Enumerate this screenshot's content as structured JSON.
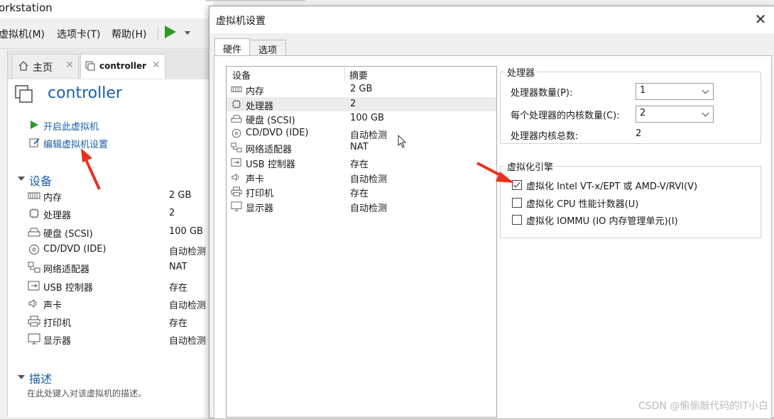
{
  "background_window": {
    "title": "orkstation",
    "menu": [
      "虚拟机(M)",
      "选项卡(T)",
      "帮助(H)"
    ],
    "tabs": [
      {
        "label": "主页"
      },
      {
        "label": "controller"
      }
    ],
    "vm_name": "controller",
    "actions": [
      "开启此虚拟机",
      "编辑虚拟机设置"
    ],
    "devices_section": "设备",
    "devices": [
      {
        "name": "内存",
        "value": "2 GB",
        "icon": "memory-icon"
      },
      {
        "name": "处理器",
        "value": "2",
        "icon": "cpu-icon"
      },
      {
        "name": "硬盘 (SCSI)",
        "value": "100 GB",
        "icon": "disk-icon"
      },
      {
        "name": "CD/DVD (IDE)",
        "value": "自动检测",
        "icon": "cd-icon"
      },
      {
        "name": "网络适配器",
        "value": "NAT",
        "icon": "network-icon"
      },
      {
        "name": "USB 控制器",
        "value": "存在",
        "icon": "usb-icon"
      },
      {
        "name": "声卡",
        "value": "自动检测",
        "icon": "sound-icon"
      },
      {
        "name": "打印机",
        "value": "存在",
        "icon": "printer-icon"
      },
      {
        "name": "显示器",
        "value": "自动检测",
        "icon": "display-icon"
      }
    ],
    "description_section": "描述",
    "description_placeholder": "在此处键入对该虚拟机的描述。"
  },
  "dialog": {
    "title": "虚拟机设置",
    "close": "✕",
    "tabs": [
      {
        "label": "硬件"
      },
      {
        "label": "选项"
      }
    ],
    "list_header": {
      "device": "设备",
      "summary": "摘要"
    },
    "devices": [
      {
        "name": "内存",
        "value": "2 GB",
        "icon": "memory-icon"
      },
      {
        "name": "处理器",
        "value": "2",
        "icon": "cpu-icon",
        "selected": true
      },
      {
        "name": "硬盘 (SCSI)",
        "value": "100 GB",
        "icon": "disk-icon"
      },
      {
        "name": "CD/DVD (IDE)",
        "value": "自动检测",
        "icon": "cd-icon"
      },
      {
        "name": "网络适配器",
        "value": "NAT",
        "icon": "network-icon"
      },
      {
        "name": "USB 控制器",
        "value": "存在",
        "icon": "usb-icon"
      },
      {
        "name": "声卡",
        "value": "自动检测",
        "icon": "sound-icon"
      },
      {
        "name": "打印机",
        "value": "存在",
        "icon": "printer-icon"
      },
      {
        "name": "显示器",
        "value": "自动检测",
        "icon": "display-icon"
      }
    ],
    "processor_group": {
      "title": "处理器",
      "count_label": "处理器数量(P):",
      "count_value": "1",
      "cores_label": "每个处理器的内核数量(C):",
      "cores_value": "2",
      "total_label": "处理器内核总数:",
      "total_value": "2"
    },
    "virt_group": {
      "title": "虚拟化引擎",
      "options": [
        {
          "label": "虚拟化 Intel VT-x/EPT 或 AMD-V/RVI(V)",
          "checked": true
        },
        {
          "label": "虚拟化 CPU 性能计数器(U)",
          "checked": false
        },
        {
          "label": "虚拟化 IOMMU (IO 内存管理单元)(I)",
          "checked": false
        }
      ]
    }
  },
  "watermark": "CSDN @偷偷敲代码的IT小白",
  "colors": {
    "accent_blue": "#1a5fa8",
    "play_green": "#2e9a2e",
    "arrow_red": "#e8321e"
  }
}
